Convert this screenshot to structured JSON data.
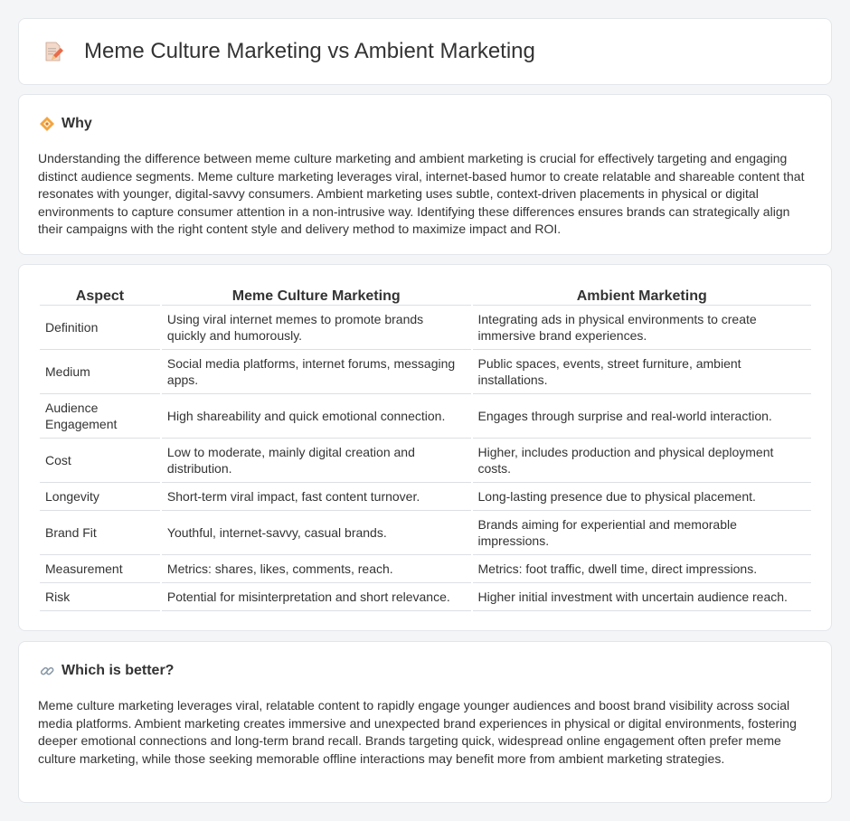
{
  "header": {
    "title": "Meme Culture Marketing vs Ambient Marketing",
    "icon": "document-pencil-icon"
  },
  "why": {
    "heading": "Why",
    "icon": "sparkle-diamond-icon",
    "body": "Understanding the difference between meme culture marketing and ambient marketing is crucial for effectively targeting and engaging distinct audience segments. Meme culture marketing leverages viral, internet-based humor to create relatable and shareable content that resonates with younger, digital-savvy consumers. Ambient marketing uses subtle, context-driven placements in physical or digital environments to capture consumer attention in a non-intrusive way. Identifying these differences ensures brands can strategically align their campaigns with the right content style and delivery method to maximize impact and ROI."
  },
  "comparison": {
    "columns": [
      "Aspect",
      "Meme Culture Marketing",
      "Ambient Marketing"
    ],
    "rows": [
      [
        "Definition",
        "Using viral internet memes to promote brands quickly and humorously.",
        "Integrating ads in physical environments to create immersive brand experiences."
      ],
      [
        "Medium",
        "Social media platforms, internet forums, messaging apps.",
        "Public spaces, events, street furniture, ambient installations."
      ],
      [
        "Audience Engagement",
        "High shareability and quick emotional connection.",
        "Engages through surprise and real-world interaction."
      ],
      [
        "Cost",
        "Low to moderate, mainly digital creation and distribution.",
        "Higher, includes production and physical deployment costs."
      ],
      [
        "Longevity",
        "Short-term viral impact, fast content turnover.",
        "Long-lasting presence due to physical placement."
      ],
      [
        "Brand Fit",
        "Youthful, internet-savvy, casual brands.",
        "Brands aiming for experiential and memorable impressions."
      ],
      [
        "Measurement",
        "Metrics: shares, likes, comments, reach.",
        "Metrics: foot traffic, dwell time, direct impressions."
      ],
      [
        "Risk",
        "Potential for misinterpretation and short relevance.",
        "Higher initial investment with uncertain audience reach."
      ]
    ]
  },
  "better": {
    "heading": "Which is better?",
    "icon": "link-icon",
    "body": "Meme culture marketing leverages viral, relatable content to rapidly engage younger audiences and boost brand visibility across social media platforms. Ambient marketing creates immersive and unexpected brand experiences in physical or digital environments, fostering deeper emotional connections and long-term brand recall. Brands targeting quick, widespread online engagement often prefer meme culture marketing, while those seeking memorable offline interactions may benefit more from ambient marketing strategies."
  },
  "colors": {
    "background": "#f4f5f7",
    "card": "#ffffff",
    "text": "#333333",
    "border": "#dcdfe3"
  }
}
